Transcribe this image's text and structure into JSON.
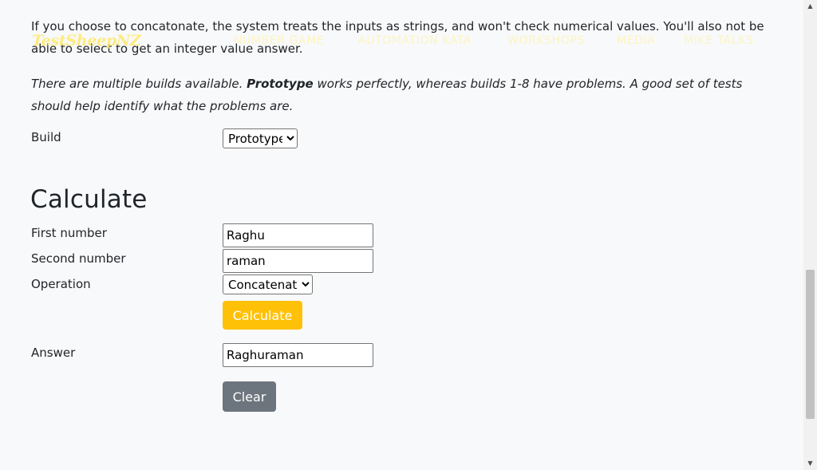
{
  "intro": {
    "concat_note": "If you choose to concatonate, the system treats the inputs as strings, and won't check numerical values. You'll also not be able to select to get an integer value answer.",
    "builds_pre": "There are multiple builds available. ",
    "builds_bold": "Prototype",
    "builds_post": " works perfectly, whereas builds 1-8 have problems. A good set of tests should help identify what the problems are."
  },
  "navbar": {
    "logo": "TestSheepNZ",
    "items": [
      "NUMBER GAME",
      "AUTOMATION KATA",
      "WORKSHOPS",
      "MEDIA",
      "MIKE TALKS"
    ]
  },
  "build": {
    "label": "Build",
    "selected": "Prototype"
  },
  "calculate": {
    "heading": "Calculate",
    "first_label": "First number",
    "first_value": "Raghu",
    "second_label": "Second number",
    "second_value": "raman",
    "operation_label": "Operation",
    "operation_selected": "Concatenate",
    "calculate_button": "Calculate",
    "answer_label": "Answer",
    "answer_value": "Raghuraman",
    "clear_button": "Clear"
  },
  "colors": {
    "calculate_button": "#ffc107",
    "clear_button": "#6c757d",
    "background": "#f8f9fa"
  }
}
